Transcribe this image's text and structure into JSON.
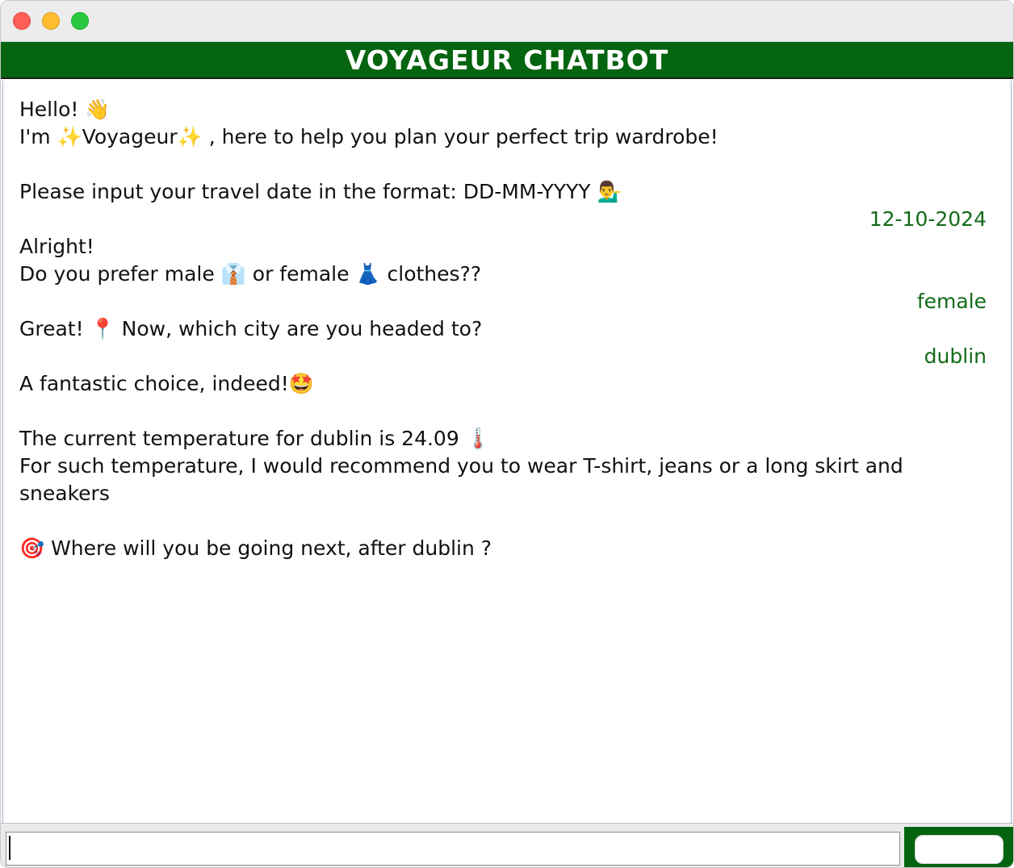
{
  "window": {
    "controls": [
      "close",
      "minimize",
      "zoom"
    ]
  },
  "header": {
    "title": "VOYAGEUR CHATBOT",
    "bg_color": "#05640f",
    "text_color": "#ffffff"
  },
  "messages": [
    {
      "sender": "bot",
      "text": "Hello! 👋"
    },
    {
      "sender": "bot",
      "text": "I'm ✨Voyageur✨ , here to help you plan your perfect trip wardrobe!"
    },
    {
      "sender": "bot",
      "text": "Please input your travel date in the format: DD-MM-YYYY 💁‍♂️"
    },
    {
      "sender": "user",
      "text": "12-10-2024"
    },
    {
      "sender": "bot",
      "text": "Alright!"
    },
    {
      "sender": "bot",
      "text": "Do you prefer male 👔 or female 👗 clothes??"
    },
    {
      "sender": "user",
      "text": "female"
    },
    {
      "sender": "bot",
      "text": "Great! 📍 Now, which city are you headed to?"
    },
    {
      "sender": "user",
      "text": "dublin"
    },
    {
      "sender": "bot",
      "text": "A fantastic choice, indeed!🤩"
    },
    {
      "sender": "bot",
      "text": "The current temperature for dublin is 24.09 🌡️"
    },
    {
      "sender": "bot",
      "text": "For such temperature, I would recommend you to wear T-shirt, jeans or a long skirt and"
    },
    {
      "sender": "bot",
      "text": "sneakers"
    },
    {
      "sender": "bot",
      "text": "🎯 Where will you be going next, after dublin ?"
    }
  ],
  "input": {
    "value": "",
    "placeholder": ""
  },
  "send_button": {
    "label": ""
  },
  "colors": {
    "user_text": "#126b18",
    "bot_text": "#111111",
    "accent": "#05640f"
  }
}
